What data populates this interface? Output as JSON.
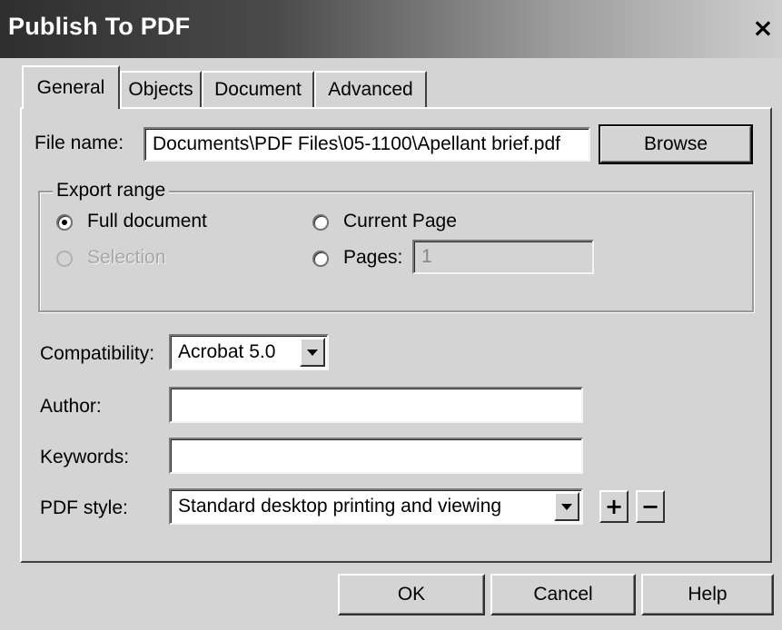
{
  "window": {
    "title": "Publish To PDF",
    "close_symbol": "×"
  },
  "tabs": [
    {
      "label": "General",
      "active": true
    },
    {
      "label": "Objects",
      "active": false
    },
    {
      "label": "Document",
      "active": false
    },
    {
      "label": "Advanced",
      "active": false
    }
  ],
  "general": {
    "file_name_label": "File name:",
    "file_name_value": "Documents\\PDF Files\\05-1100\\Apellant brief.pdf",
    "browse_label": "Browse",
    "export_range": {
      "title": "Export range",
      "full_document": "Full document",
      "selection": "Selection",
      "current_page": "Current Page",
      "pages": "Pages:",
      "pages_value": "1",
      "selected": "full_document"
    },
    "compatibility_label": "Compatibility:",
    "compatibility_value": "Acrobat 5.0",
    "author_label": "Author:",
    "author_value": "",
    "keywords_label": "Keywords:",
    "keywords_value": "",
    "pdf_style_label": "PDF style:",
    "pdf_style_value": "Standard desktop printing and viewing",
    "add_style_symbol": "+",
    "remove_style_symbol": "−"
  },
  "footer": {
    "ok_label": "OK",
    "cancel_label": "Cancel",
    "help_label": "Help"
  }
}
